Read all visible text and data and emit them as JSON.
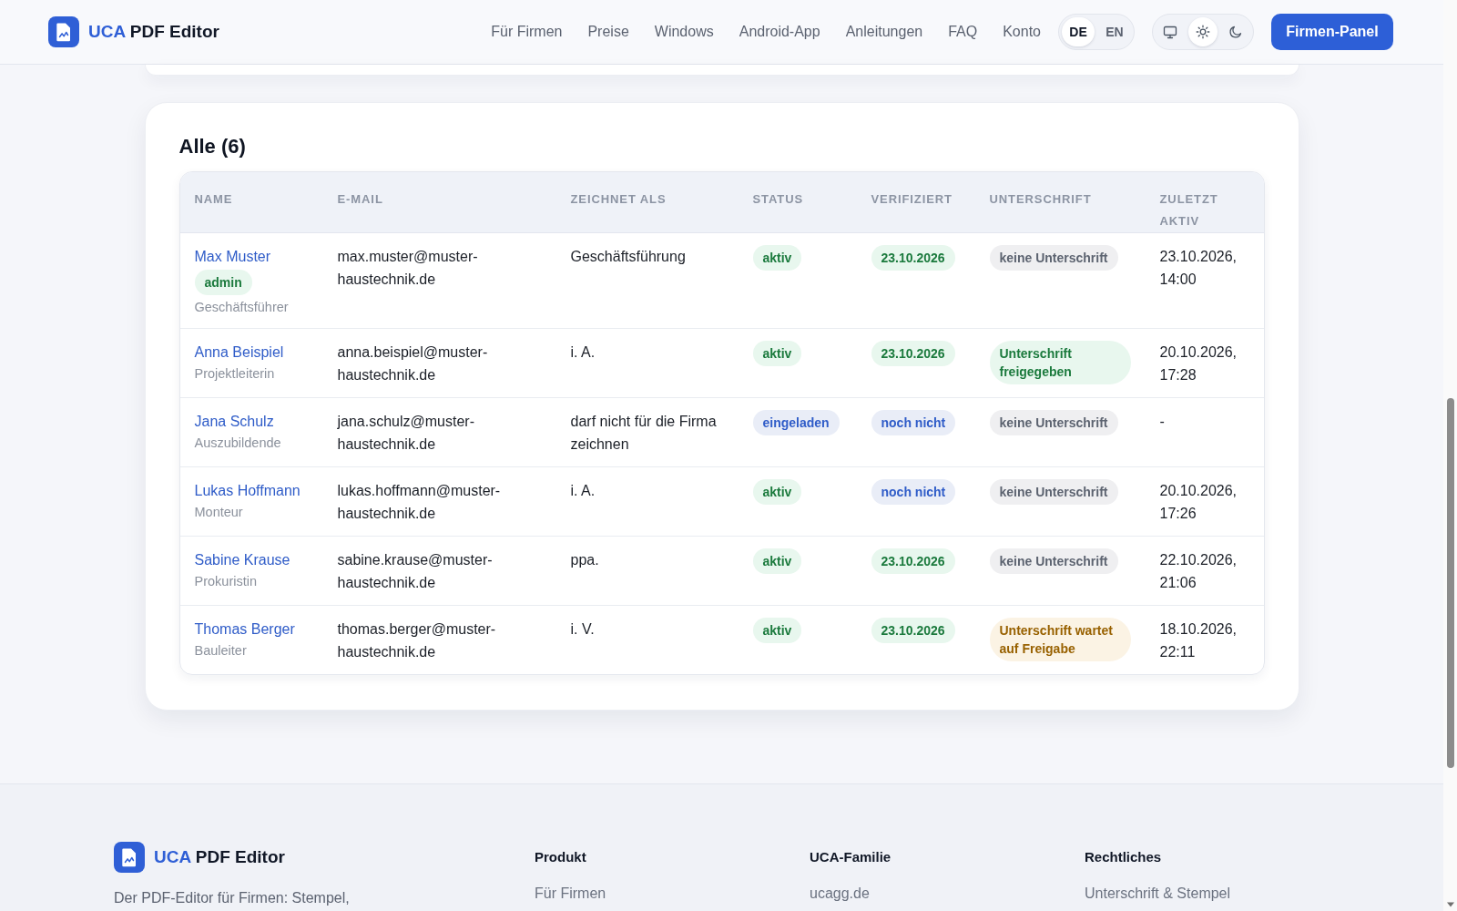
{
  "header": {
    "logo": {
      "accent": "UCA",
      "name": "PDF Editor"
    },
    "nav_links": [
      "Für Firmen",
      "Preise",
      "Windows",
      "Android-App",
      "Anleitungen",
      "FAQ",
      "Konto"
    ],
    "languages": [
      {
        "label": "DE",
        "selected": true
      },
      {
        "label": "EN",
        "selected": false
      }
    ],
    "theme_modes": [
      {
        "kind": "system",
        "selected": false
      },
      {
        "kind": "light",
        "selected": true
      },
      {
        "kind": "dark",
        "selected": false
      }
    ],
    "cta_button": "Firmen-Panel"
  },
  "members_card": {
    "title": "Alle (6)",
    "table": {
      "columns": [
        "NAME",
        "E-MAIL",
        "ZEICHNET ALS",
        "STATUS",
        "VERIFIZIERT",
        "UNTERSCHRIFT",
        "ZULETZT AKTIV"
      ],
      "rows": [
        {
          "name": "Max Muster",
          "role_badge": {
            "text": "admin",
            "color": "#1b7a3d"
          },
          "position": "Geschäftsführer",
          "email": "max.muster@muster-haustechnik.de",
          "signs_as": "Geschäftsführung",
          "status": {
            "text": "aktiv",
            "color": "#1b7a3d"
          },
          "verified": {
            "text": "23.10.2026",
            "color": "#1b7a3d"
          },
          "signature": {
            "text": "keine Unterschrift",
            "color": "#5c6370"
          },
          "last_active": "23.10.2026, 14:00"
        },
        {
          "name": "Anna Beispiel",
          "position": "Projektleiterin",
          "email": "anna.beispiel@muster-haustechnik.de",
          "signs_as": "i. A.",
          "status": {
            "text": "aktiv",
            "color": "#1b7a3d"
          },
          "verified": {
            "text": "23.10.2026",
            "color": "#1b7a3d"
          },
          "signature": {
            "text": "Unterschrift freigegeben",
            "color": "#1b7a3d"
          },
          "last_active": "20.10.2026, 17:28"
        },
        {
          "name": "Jana Schulz",
          "position": "Auszubildende",
          "email": "jana.schulz@muster-haustechnik.de",
          "signs_as": "darf nicht für die Firma zeichnen",
          "status": {
            "text": "eingeladen",
            "color": "#2f5cc8"
          },
          "verified": {
            "text": "noch nicht",
            "color": "#2f5cc8"
          },
          "signature": {
            "text": "keine Unterschrift",
            "color": "#5c6370"
          },
          "last_active": "-"
        },
        {
          "name": "Lukas Hoffmann",
          "position": "Monteur",
          "email": "lukas.hoffmann@muster-haustechnik.de",
          "signs_as": "i. A.",
          "status": {
            "text": "aktiv",
            "color": "#1b7a3d"
          },
          "verified": {
            "text": "noch nicht",
            "color": "#2f5cc8"
          },
          "signature": {
            "text": "keine Unterschrift",
            "color": "#5c6370"
          },
          "last_active": "20.10.2026, 17:26"
        },
        {
          "name": "Sabine Krause",
          "position": "Prokuristin",
          "email": "sabine.krause@muster-haustechnik.de",
          "signs_as": "ppa.",
          "status": {
            "text": "aktiv",
            "color": "#1b7a3d"
          },
          "verified": {
            "text": "23.10.2026",
            "color": "#1b7a3d"
          },
          "signature": {
            "text": "keine Unterschrift",
            "color": "#5c6370"
          },
          "last_active": "22.10.2026, 21:06"
        },
        {
          "name": "Thomas Berger",
          "position": "Bauleiter",
          "email": "thomas.berger@muster-haustechnik.de",
          "signs_as": "i. V.",
          "status": {
            "text": "aktiv",
            "color": "#1b7a3d"
          },
          "verified": {
            "text": "23.10.2026",
            "color": "#1b7a3d"
          },
          "signature": {
            "text": "Unterschrift wartet auf Freigabe",
            "color": "#986100"
          },
          "last_active": "18.10.2026, 22:11"
        }
      ]
    }
  },
  "footer": {
    "logo": {
      "accent": "UCA",
      "name": "PDF Editor"
    },
    "description": "Der PDF-Editor für Firmen: Stempel,",
    "columns": [
      {
        "heading": "Produkt",
        "links": [
          "Für Firmen"
        ]
      },
      {
        "heading": "UCA-Familie",
        "links": [
          "ucagg.de"
        ]
      },
      {
        "heading": "Rechtliches",
        "links": [
          "Unterschrift & Stempel"
        ]
      }
    ]
  }
}
